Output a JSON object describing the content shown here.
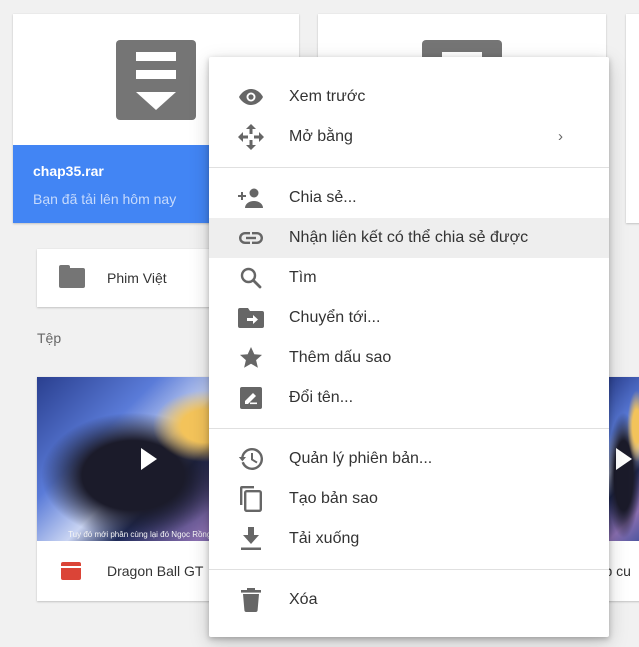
{
  "top_card": {
    "file_name": "chap35.rar",
    "file_subtitle": "Bạn đã tải lên hôm nay"
  },
  "folder": {
    "name": "Phim Việt"
  },
  "files_section": {
    "label": "Tệp"
  },
  "videos": [
    {
      "name": "Dragon Ball GT",
      "caption": "Tuy đó mới phân cùng lại đó Ngọc Rồng trở thành"
    },
    {
      "name": "ráp cu"
    }
  ],
  "context_menu": {
    "group1": [
      {
        "label": "Xem trước",
        "icon": "eye-icon"
      },
      {
        "label": "Mở bằng",
        "icon": "move-icon",
        "submenu": true
      }
    ],
    "group2": [
      {
        "label": "Chia sẻ...",
        "icon": "person-add-icon"
      },
      {
        "label": "Nhận liên kết có thể chia sẻ được",
        "icon": "link-icon"
      },
      {
        "label": "Tìm",
        "icon": "search-icon"
      },
      {
        "label": "Chuyển tới...",
        "icon": "folder-move-icon"
      },
      {
        "label": "Thêm dấu sao",
        "icon": "star-icon"
      },
      {
        "label": "Đổi tên...",
        "icon": "rename-icon"
      }
    ],
    "group3": [
      {
        "label": "Quản lý phiên bản...",
        "icon": "history-icon"
      },
      {
        "label": "Tạo bản sao",
        "icon": "copy-icon"
      },
      {
        "label": "Tải xuống",
        "icon": "download-icon"
      }
    ],
    "group4": [
      {
        "label": "Xóa",
        "icon": "trash-icon"
      }
    ]
  },
  "colors": {
    "selected": "#4285f4",
    "icon": "#757575",
    "video_icon": "#db4437"
  }
}
